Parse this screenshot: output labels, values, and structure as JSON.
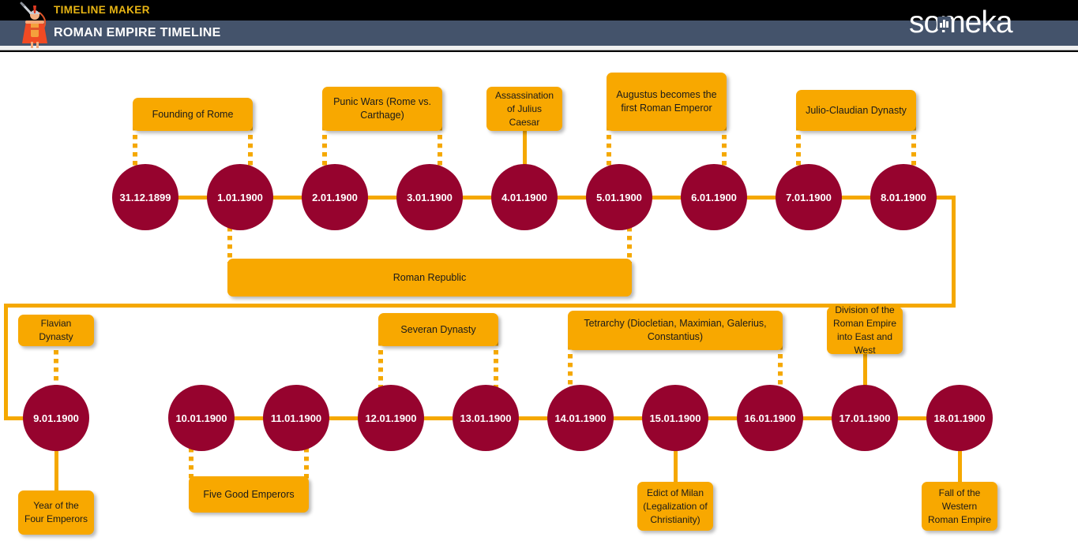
{
  "header": {
    "brand_title": "TIMELINE MAKER",
    "page_title": "ROMAN EMPIRE TIMELINE",
    "logo_text": "someka",
    "logo_icon": "bar-chart-icon",
    "mascot_icon": "roman-soldier-icon",
    "colors": {
      "top_band": "#000000",
      "title_band": "#44536b",
      "brand_text": "#e8b514",
      "title_text": "#ffffff"
    }
  },
  "theme": {
    "node_fill": "#96032e",
    "node_text": "#ffffff",
    "accent_orange": "#f5a800",
    "card_fill": "#f8a800",
    "card_text": "#1a1a1a",
    "background": "#ffffff"
  },
  "timeline": {
    "rows": [
      {
        "row": 1,
        "nodes": [
          {
            "date": "31.12.1899"
          },
          {
            "date": "1.01.1900"
          },
          {
            "date": "2.01.1900"
          },
          {
            "date": "3.01.1900"
          },
          {
            "date": "4.01.1900"
          },
          {
            "date": "5.01.1900"
          },
          {
            "date": "6.01.1900"
          },
          {
            "date": "7.01.1900"
          },
          {
            "date": "8.01.1900"
          }
        ]
      },
      {
        "row": 2,
        "nodes": [
          {
            "date": "9.01.1900"
          },
          {
            "date": "10.01.1900"
          },
          {
            "date": "11.01.1900"
          },
          {
            "date": "12.01.1900"
          },
          {
            "date": "13.01.1900"
          },
          {
            "date": "14.01.1900"
          },
          {
            "date": "15.01.1900"
          },
          {
            "date": "16.01.1900"
          },
          {
            "date": "17.01.1900"
          },
          {
            "date": "18.01.1900"
          }
        ]
      }
    ],
    "events": [
      {
        "id": "founding-of-rome",
        "label": "Founding of Rome",
        "anchors": [
          "31.12.1899",
          "1.01.1900"
        ],
        "position": "above",
        "connector": "dotted",
        "kind": "span"
      },
      {
        "id": "punic-wars",
        "label": "Punic Wars (Rome vs. Carthage)",
        "anchors": [
          "2.01.1900",
          "3.01.1900"
        ],
        "position": "above",
        "connector": "dotted",
        "kind": "span"
      },
      {
        "id": "assassination-of-caesar",
        "label": "Assassination of Julius Caesar",
        "anchors": [
          "4.01.1900"
        ],
        "position": "above",
        "connector": "solid",
        "kind": "point"
      },
      {
        "id": "augustus-first-emperor",
        "label": "Augustus becomes the first Roman Emperor",
        "anchors": [
          "5.01.1900",
          "6.01.1900"
        ],
        "position": "above",
        "connector": "dotted",
        "kind": "span"
      },
      {
        "id": "julio-claudian-dynasty",
        "label": "Julio-Claudian Dynasty",
        "anchors": [
          "7.01.1900",
          "8.01.1900"
        ],
        "position": "above",
        "connector": "dotted",
        "kind": "span"
      },
      {
        "id": "roman-republic",
        "label": "Roman Republic",
        "anchors": [
          "1.01.1900",
          "5.01.1900"
        ],
        "position": "below",
        "connector": "dotted",
        "kind": "span"
      },
      {
        "id": "flavian-dynasty",
        "label": "Flavian Dynasty",
        "anchors": [
          "9.01.1900"
        ],
        "position": "above",
        "connector": "dotted",
        "kind": "point"
      },
      {
        "id": "severan-dynasty",
        "label": "Severan Dynasty",
        "anchors": [
          "12.01.1900",
          "13.01.1900"
        ],
        "position": "above",
        "connector": "dotted",
        "kind": "span"
      },
      {
        "id": "tetrarchy",
        "label": "Tetrarchy (Diocletian, Maximian, Galerius, Constantius)",
        "anchors": [
          "14.01.1900",
          "16.01.1900"
        ],
        "position": "above",
        "connector": "dotted",
        "kind": "span"
      },
      {
        "id": "division-of-empire",
        "label": "Division of the Roman Empire into East and West",
        "anchors": [
          "17.01.1900"
        ],
        "position": "above",
        "connector": "solid",
        "kind": "point"
      },
      {
        "id": "year-of-four-emperors",
        "label": "Year of the Four Emperors",
        "anchors": [
          "9.01.1900"
        ],
        "position": "below",
        "connector": "solid",
        "kind": "point"
      },
      {
        "id": "five-good-emperors",
        "label": "Five Good Emperors",
        "anchors": [
          "10.01.1900",
          "11.01.1900"
        ],
        "position": "below",
        "connector": "dotted",
        "kind": "span"
      },
      {
        "id": "edict-of-milan",
        "label": "Edict of Milan (Legalization of Christianity)",
        "anchors": [
          "15.01.1900"
        ],
        "position": "below",
        "connector": "solid",
        "kind": "point"
      },
      {
        "id": "fall-of-western-empire",
        "label": "Fall of the Western Roman Empire",
        "anchors": [
          "18.01.1900"
        ],
        "position": "below",
        "connector": "solid",
        "kind": "point"
      }
    ]
  }
}
